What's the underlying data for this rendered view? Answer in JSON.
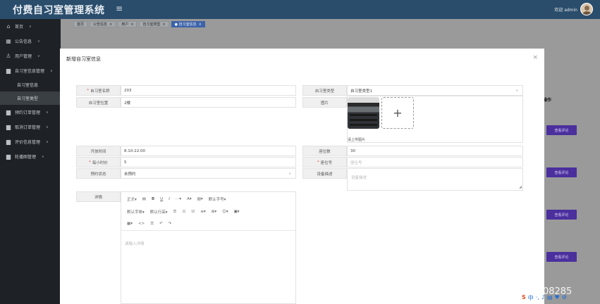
{
  "app": {
    "title": "付费自习室管理系统",
    "user_greeting": "欢迎 admin",
    "menu_toggle_icon": "hamburger-icon"
  },
  "sidebar": {
    "items": [
      {
        "label": "首页",
        "icon": "home-icon"
      },
      {
        "label": "公告信息",
        "icon": "grid-icon"
      },
      {
        "label": "用户管理",
        "icon": "user-icon"
      },
      {
        "label": "自习室信息管理",
        "icon": "folder-icon",
        "expanded": true,
        "children": [
          {
            "label": "自习室信息"
          },
          {
            "label": "自习室类型",
            "active": true
          }
        ]
      },
      {
        "label": "预约订单管理",
        "icon": "folder-icon"
      },
      {
        "label": "取消订单管理",
        "icon": "folder-icon"
      },
      {
        "label": "评价信息管理",
        "icon": "folder-icon"
      },
      {
        "label": "轮播图管理",
        "icon": "folder-icon"
      }
    ]
  },
  "tabs": [
    {
      "label": "首页"
    },
    {
      "label": "公告信息"
    },
    {
      "label": "用户"
    },
    {
      "label": "自习室类型"
    },
    {
      "label": "● 自习室信息",
      "active": true
    }
  ],
  "list": {
    "ops_header": "操作",
    "view_button_label": "查看评论"
  },
  "modal": {
    "title": "新增自习室信息",
    "close_icon": "close-icon",
    "fields": {
      "name": {
        "label": "自习室名称",
        "required": true,
        "value": "203"
      },
      "location": {
        "label": "自习室位置",
        "required": false,
        "value": "2楼"
      },
      "open_time": {
        "label": "开放时间",
        "required": false,
        "value": "8.10-22.00"
      },
      "hourly_price": {
        "label": "每小时价",
        "required": true,
        "value": "5"
      },
      "booking_status": {
        "label": "预约状态",
        "required": false,
        "value": "未预约"
      },
      "type": {
        "label": "自习室类型",
        "required": false,
        "value": "自习室类型1"
      },
      "image": {
        "label": "图片",
        "hint": "请上传图片"
      },
      "seat_count": {
        "label": "座位数",
        "required": false,
        "value": "30"
      },
      "seat_no": {
        "label": "座位号",
        "required": true,
        "placeholder": "座位号"
      },
      "equipment": {
        "label": "设备描述",
        "placeholder": "设备描述"
      },
      "details": {
        "label": "详情",
        "placeholder": "请输入详情"
      }
    },
    "editor_toolbar": {
      "row1": [
        "正文▾",
        "▤",
        "B",
        "U",
        "I",
        "⋯▾",
        "A▾",
        "▨▾",
        "默认字号▾"
      ],
      "row2": [
        "默认字体▾",
        "默认行高▾",
        "☰",
        "☷",
        "☑",
        "≡▾",
        "⊞▾",
        "☺▾",
        "▣▾"
      ],
      "row3": [
        "▦▾",
        "<>",
        "☰",
        "↶",
        "↷"
      ]
    }
  },
  "watermark": "CSDN @QQ_51008285"
}
